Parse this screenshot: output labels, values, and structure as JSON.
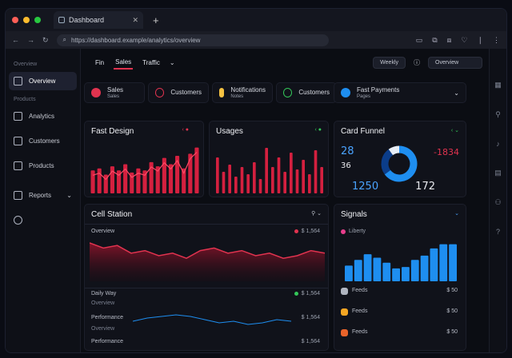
{
  "browser": {
    "tab_title": "Dashboard",
    "url": "https://dashboard.example/analytics/overview"
  },
  "sidebar": {
    "section1": "Overview",
    "section2": "Products",
    "items": [
      {
        "label": "Overview",
        "icon": "home-icon",
        "active": true
      },
      {
        "label": "Analytics",
        "icon": "chart-icon"
      },
      {
        "label": "Customers",
        "icon": "users-icon"
      },
      {
        "label": "Products",
        "icon": "box-icon"
      },
      {
        "label": "Reports",
        "icon": "folder-icon"
      },
      {
        "label": "",
        "icon": "settings-icon"
      }
    ]
  },
  "toolbar": {
    "tabs": [
      "Fin",
      "Sales",
      "Traffic"
    ],
    "filter_label": "Weekly",
    "date_label": "Overview"
  },
  "stats": [
    {
      "title": "Sales",
      "sub": "Sales",
      "color": "#e1334f",
      "shape": "circle"
    },
    {
      "title": "Customers",
      "sub": "",
      "color": "#e1334f",
      "shape": "ring"
    },
    {
      "title": "Notifications",
      "sub": "Notes",
      "color": "#f5c242",
      "shape": "square"
    },
    {
      "title": "Customers",
      "sub": "",
      "color": "#34c759",
      "shape": "ring"
    },
    {
      "title": "Fast Payments",
      "sub": "Pages",
      "color": "#1e8ef0",
      "shape": "circle"
    }
  ],
  "card_sales": {
    "title": "Fast Design",
    "values": [
      22,
      24,
      18,
      26,
      22,
      28,
      20,
      24,
      22,
      30,
      26,
      34,
      28,
      36,
      24,
      38,
      44
    ]
  },
  "card_usage": {
    "title": "Usages",
    "values": [
      30,
      18,
      24,
      14,
      22,
      16,
      26,
      12,
      38,
      22,
      30,
      18,
      34,
      20,
      28,
      16,
      36,
      22
    ]
  },
  "card_funnel": {
    "title": "Card Funnel",
    "left_top": "28",
    "right_top": "-1834",
    "left_mid": "36",
    "bottom_left": "1250",
    "bottom_right": "172",
    "donut": [
      {
        "value": 65,
        "color": "#1e8ef0"
      },
      {
        "value": 25,
        "color": "#0b3d8a"
      },
      {
        "value": 10,
        "color": "#e8eef6"
      }
    ]
  },
  "card_station": {
    "title": "Cell Station",
    "rows": [
      {
        "label": "Overview",
        "sub": "",
        "legend": "$ 1,564"
      },
      {
        "label": "Daily Way",
        "sub": "Overview",
        "legend": "$ 1,564"
      },
      {
        "label": "Performance",
        "sub": "Overview",
        "legend": "$ 1,564"
      },
      {
        "label": "Performance",
        "sub": "",
        "legend": "$ 1,564"
      }
    ],
    "line_values": [
      30,
      26,
      28,
      22,
      24,
      20,
      22,
      18,
      24,
      26,
      22,
      24,
      20,
      22,
      18,
      20,
      24,
      22
    ]
  },
  "card_signals": {
    "title": "Signals",
    "legend": "Liberty",
    "bars": [
      22,
      30,
      38,
      33,
      26,
      18,
      20,
      30,
      36,
      46,
      52,
      52
    ],
    "rows": [
      {
        "label": "Feeds",
        "value": "$ 50"
      },
      {
        "label": "Feeds",
        "value": "$ 50"
      },
      {
        "label": "Feeds",
        "value": "$ 50"
      }
    ]
  }
}
